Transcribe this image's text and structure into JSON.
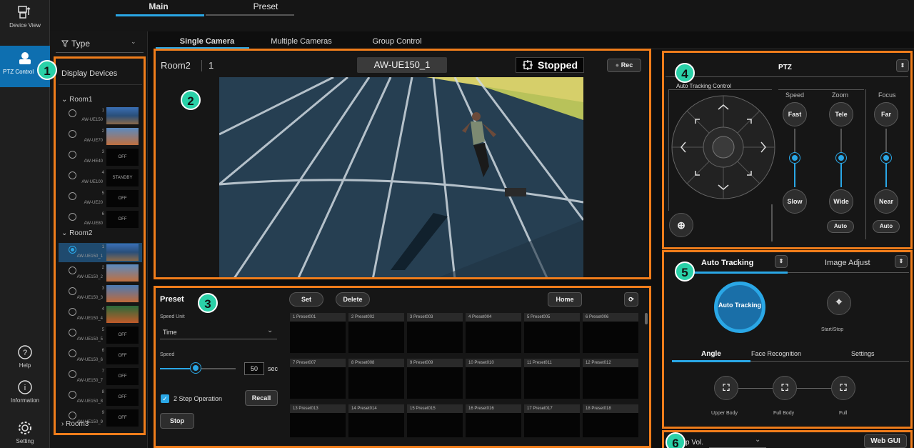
{
  "sidebar": {
    "device_view": "Device View",
    "ptz_control": "PTZ Control",
    "help": "Help",
    "information": "Information",
    "settings": "Setting"
  },
  "top_tabs": [
    "Main",
    "Preset"
  ],
  "filter": {
    "type_label": "Type"
  },
  "device_panel": {
    "title": "Display Devices",
    "rooms": [
      "Room1",
      "Room2",
      "Room3"
    ],
    "room1": [
      {
        "num": "1",
        "model": "AW-UE150",
        "thumb": ""
      },
      {
        "num": "2",
        "model": "AW-UE70",
        "thumb": ""
      },
      {
        "num": "3",
        "model": "AW-HE40",
        "thumb": "OFF"
      },
      {
        "num": "4",
        "model": "AW-UE100",
        "thumb": "STANDBY"
      },
      {
        "num": "5",
        "model": "AW-UE20",
        "thumb": "OFF"
      },
      {
        "num": "6",
        "model": "AW-UE80",
        "thumb": "OFF"
      }
    ],
    "room2": [
      {
        "num": "1",
        "model": "AW-UE150_1",
        "thumb": ""
      },
      {
        "num": "2",
        "model": "AW-UE150_2",
        "thumb": ""
      },
      {
        "num": "3",
        "model": "AW-UE150_3",
        "thumb": ""
      },
      {
        "num": "4",
        "model": "AW-UE150_4",
        "thumb": ""
      },
      {
        "num": "5",
        "model": "AW-UE150_5",
        "thumb": "OFF"
      },
      {
        "num": "6",
        "model": "AW-UE150_6",
        "thumb": "OFF"
      },
      {
        "num": "7",
        "model": "AW-UE150_7",
        "thumb": "OFF"
      },
      {
        "num": "8",
        "model": "AW-UE150_8",
        "thumb": "OFF"
      },
      {
        "num": "9",
        "model": "AW-UE150_9",
        "thumb": "OFF"
      }
    ]
  },
  "sub_tabs": [
    "Single Camera",
    "Multiple Cameras",
    "Group Control"
  ],
  "camera": {
    "room": "Room2",
    "number": "1",
    "name": "AW-UE150_1",
    "status": "Stopped",
    "rec": "Rec"
  },
  "preset": {
    "title": "Preset",
    "speed_unit_label": "Speed Unit",
    "speed_unit_value": "Time",
    "speed_label": "Speed",
    "speed_value": "50",
    "speed_unit": "sec",
    "two_step": "2 Step Operation",
    "recall": "Recall",
    "stop": "Stop",
    "set": "Set",
    "delete": "Delete",
    "home": "Home",
    "items": [
      "Preset001",
      "Preset002",
      "Preset003",
      "Preset004",
      "Preset005",
      "Preset006",
      "Preset007",
      "Preset008",
      "Preset009",
      "Preset010",
      "Preset011",
      "Preset012",
      "Preset013",
      "Preset014",
      "Preset015",
      "Preset016",
      "Preset017",
      "Preset018"
    ]
  },
  "ptz": {
    "title": "PTZ",
    "auto_tracking_control": "Auto Tracking Control",
    "speed": "Speed",
    "zoom": "Zoom",
    "focus": "Focus",
    "fast": "Fast",
    "slow": "Slow",
    "tele": "Tele",
    "wide": "Wide",
    "far": "Far",
    "near": "Near",
    "auto": "Auto"
  },
  "auto_tracking": {
    "tab1": "Auto Tracking",
    "tab2": "Image Adjust",
    "button": "Auto Tracking",
    "start_stop": "Start/Stop",
    "subtabs": [
      "Angle",
      "Face Recognition",
      "Settings"
    ],
    "angles": [
      "Upper Body",
      "Full Body",
      "Full"
    ]
  },
  "bottom": {
    "vol_label": "p Vol.",
    "web_gui": "Web GUI"
  },
  "badges": [
    "1",
    "2",
    "3",
    "4",
    "5",
    "6"
  ],
  "accent": "#2aa7e6",
  "highlight": "#f07d1b"
}
